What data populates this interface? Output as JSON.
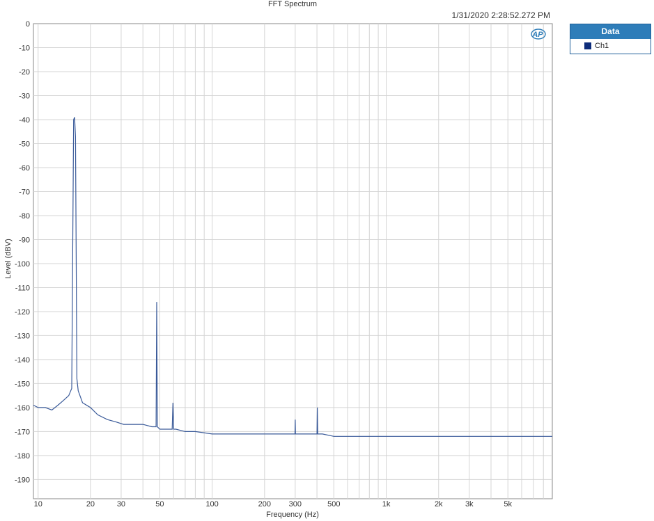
{
  "header": {
    "title": "FFT Spectrum",
    "timestamp": "1/31/2020 2:28:52.272 PM"
  },
  "legend": {
    "header": "Data",
    "items": [
      {
        "label": "Ch1",
        "color": "#0d2c7a"
      }
    ]
  },
  "logo": {
    "text": "AP",
    "icon": "ap-logo-icon"
  },
  "chart_data": {
    "type": "line",
    "title": "FFT Spectrum",
    "xlabel": "Frequency (Hz)",
    "ylabel": "Level (dBV)",
    "xscale": "log",
    "xlim": [
      9.4,
      9000
    ],
    "ylim": [
      -198,
      0
    ],
    "x_ticks": [
      10,
      20,
      30,
      50,
      100,
      200,
      300,
      500,
      1000,
      2000,
      3000,
      5000
    ],
    "x_tick_labels": [
      "10",
      "20",
      "30",
      "50",
      "100",
      "200",
      "300",
      "500",
      "1k",
      "2k",
      "3k",
      "5k"
    ],
    "y_ticks": [
      0,
      -10,
      -20,
      -30,
      -40,
      -50,
      -60,
      -70,
      -80,
      -90,
      -100,
      -110,
      -120,
      -130,
      -140,
      -150,
      -160,
      -170,
      -180,
      -190
    ],
    "y_tick_labels": [
      "0",
      "-10",
      "-20",
      "-30",
      "-40",
      "-50",
      "-60",
      "-70",
      "-80",
      "-90",
      "-100",
      "-110",
      "-120",
      "-130",
      "-140",
      "-150",
      "-160",
      "-170",
      "-180",
      "-190"
    ],
    "grid": true,
    "series": [
      {
        "name": "Ch1",
        "color": "#3a5a99",
        "x": [
          9.4,
          10,
          11,
          12,
          13,
          14,
          15,
          15.6,
          16.0,
          16.2,
          16.4,
          16.7,
          17,
          18,
          20,
          22,
          25,
          28,
          31,
          35,
          40,
          45,
          47.6,
          48.0,
          48.4,
          50,
          55,
          58.9,
          59.5,
          60.1,
          62,
          70,
          80,
          100,
          130,
          170,
          220,
          280,
          299,
          300,
          301,
          320,
          380,
          400,
          402,
          404,
          430,
          500,
          700,
          1000,
          1500,
          2000,
          3000,
          4000,
          5000,
          6000,
          7000,
          8000,
          9000
        ],
        "values": [
          -159,
          -160,
          -160,
          -161,
          -159,
          -157,
          -155,
          -152,
          -40,
          -39,
          -47,
          -148,
          -153,
          -158,
          -160,
          -163,
          -165,
          -166,
          -167,
          -167,
          -167,
          -168,
          -168,
          -116,
          -168,
          -169,
          -169,
          -169,
          -158,
          -169,
          -169,
          -170,
          -170,
          -171,
          -171,
          -171,
          -171,
          -171,
          -171,
          -165,
          -171,
          -171,
          -171,
          -171,
          -160,
          -171,
          -171,
          -172,
          -172,
          -172,
          -172,
          -172,
          -172,
          -172,
          -172,
          -172,
          -172,
          -172,
          -172
        ]
      }
    ]
  }
}
